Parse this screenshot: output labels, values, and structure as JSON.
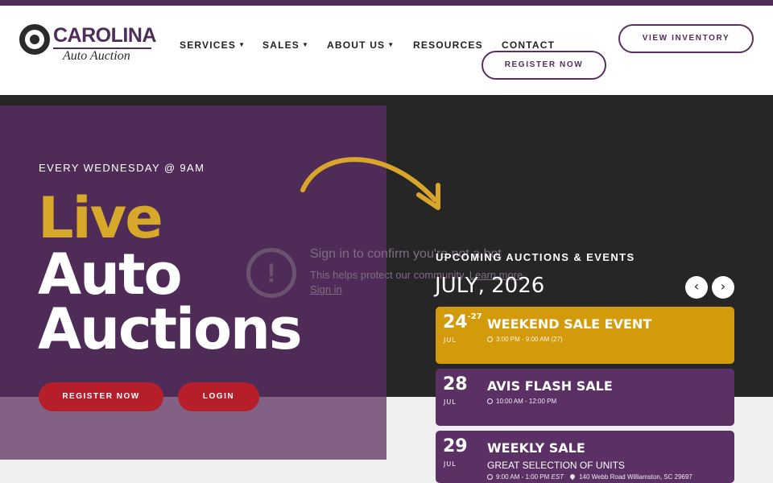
{
  "logo": {
    "name": "CAROLINA",
    "subtitle": "Auto Auction"
  },
  "nav": {
    "items": [
      {
        "label": "SERVICES",
        "has_dropdown": true
      },
      {
        "label": "SALES",
        "has_dropdown": true
      },
      {
        "label": "ABOUT US",
        "has_dropdown": true
      },
      {
        "label": "RESOURCES",
        "has_dropdown": false
      },
      {
        "label": "CONTACT",
        "has_dropdown": false
      }
    ],
    "view_inventory": "VIEW INVENTORY",
    "register_now": "REGISTER NOW"
  },
  "hero": {
    "eyebrow": "EVERY WEDNESDAY @ 9AM",
    "headline": [
      "Live",
      "Auto",
      "Auctions"
    ],
    "register_button": "REGISTER NOW",
    "login_button": "LOGIN"
  },
  "bot_check": {
    "title": "Sign in to confirm you're not a bot",
    "body": "This helps protect our community.",
    "learn_more": "Learn more",
    "sign_in": "Sign in"
  },
  "events": {
    "heading": "UPCOMING AUCTIONS & EVENTS",
    "month": "JULY, 2026",
    "prev_icon": "chevron-left-icon",
    "next_icon": "chevron-right-icon",
    "items": [
      {
        "day": "24",
        "day_end": "-27",
        "month": "JUL",
        "title": "WEEKEND SALE EVENT",
        "subtitle": "",
        "time": "3:00 PM - 9:00 AM (27)",
        "timezone": "",
        "location": ""
      },
      {
        "day": "28",
        "day_end": "",
        "month": "JUL",
        "title": "AVIS FLASH SALE",
        "subtitle": "",
        "time": "10:00 AM - 12:00 PM",
        "timezone": "",
        "location": ""
      },
      {
        "day": "29",
        "day_end": "",
        "month": "JUL",
        "title": "WEEKLY SALE",
        "subtitle": "GREAT SELECTION OF UNITS",
        "time": "9:00 AM - 1:00 PM",
        "timezone": "EST",
        "location": "140 Webb Road Williamston, SC 29697"
      }
    ]
  },
  "colors": {
    "brand_purple": "#4e2d5a",
    "gold": "#d7a82a",
    "red": "#b61f2a",
    "dark": "#262626"
  }
}
